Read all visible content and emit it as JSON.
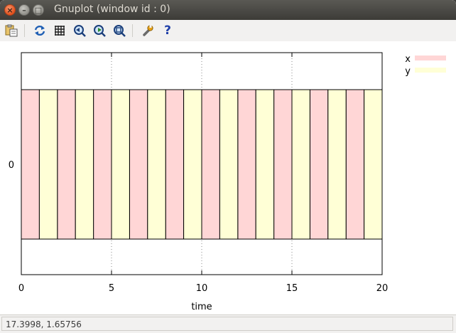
{
  "window": {
    "title": "Gnuplot (window id : 0)",
    "close_glyph": "×",
    "minimize_glyph": "–",
    "maximize_glyph": "□"
  },
  "toolbar": {
    "icons": [
      "copy-to-clipboard-icon",
      "replot-icon",
      "grid-icon",
      "zoom-previous-icon",
      "zoom-next-icon",
      "autoscale-icon",
      "configure-icon",
      "help-icon"
    ],
    "help_glyph": "?"
  },
  "status": {
    "coordinates": "17.3998,  1.65756"
  },
  "chart_data": {
    "type": "bar",
    "style": "stacked rectangles alternating series",
    "x": [
      0,
      1,
      2,
      3,
      4,
      5,
      6,
      7,
      8,
      9,
      10,
      11,
      12,
      13,
      14,
      15,
      16,
      17,
      18,
      19
    ],
    "series": [
      {
        "name": "x",
        "color": "#ffd6d6",
        "intervals": [
          [
            0,
            1
          ],
          [
            2,
            3
          ],
          [
            4,
            5
          ],
          [
            6,
            7
          ],
          [
            8,
            9
          ],
          [
            10,
            11
          ],
          [
            12,
            13
          ],
          [
            14,
            15
          ],
          [
            16,
            17
          ],
          [
            18,
            19
          ]
        ]
      },
      {
        "name": "y",
        "color": "#ffffd6",
        "intervals": [
          [
            1,
            2
          ],
          [
            3,
            4
          ],
          [
            5,
            6
          ],
          [
            7,
            8
          ],
          [
            9,
            10
          ],
          [
            11,
            12
          ],
          [
            13,
            14
          ],
          [
            15,
            16
          ],
          [
            17,
            18
          ],
          [
            19,
            20
          ]
        ]
      }
    ],
    "xlabel": "time",
    "xlim": [
      0,
      20
    ],
    "xticks": [
      "0",
      "5",
      "10",
      "15",
      "20"
    ],
    "yticks": [
      "0"
    ],
    "grid": "vertical dotted at major x ticks",
    "legend": "top-right"
  }
}
